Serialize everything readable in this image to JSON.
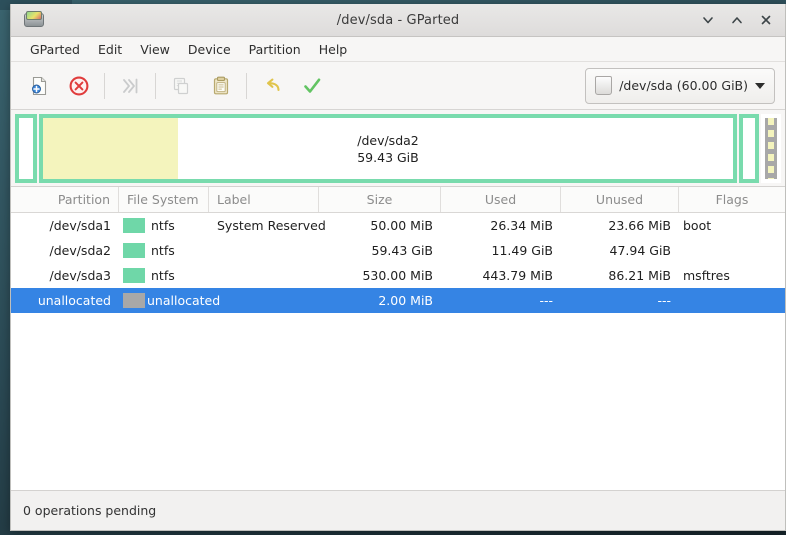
{
  "window": {
    "title": "/dev/sda - GParted",
    "app_icon": "hard-disk-icon",
    "controls": [
      {
        "name": "minimize-button",
        "icon": "chevron-down-icon"
      },
      {
        "name": "maximize-button",
        "icon": "chevron-up-icon"
      },
      {
        "name": "close-button",
        "icon": "close-x-icon"
      }
    ]
  },
  "menubar": {
    "items": [
      {
        "label": "GParted"
      },
      {
        "label": "Edit"
      },
      {
        "label": "View"
      },
      {
        "label": "Device"
      },
      {
        "label": "Partition"
      },
      {
        "label": "Help"
      }
    ]
  },
  "toolbar": {
    "buttons": [
      {
        "name": "new-partition-button",
        "icon": "new-document-icon",
        "enabled": true
      },
      {
        "name": "delete-partition-button",
        "icon": "delete-circle-icon",
        "enabled": true
      },
      {
        "name": "resize-move-button",
        "icon": "resize-move-icon",
        "enabled": false
      },
      {
        "name": "copy-button",
        "icon": "copy-icon",
        "enabled": false
      },
      {
        "name": "paste-button",
        "icon": "paste-clipboard-icon",
        "enabled": true
      },
      {
        "name": "undo-button",
        "icon": "undo-arrow-icon",
        "enabled": true
      },
      {
        "name": "apply-button",
        "icon": "apply-checkmark-icon",
        "enabled": true
      }
    ],
    "device_select": {
      "label": "/dev/sda (60.00 GiB)",
      "icon": "hard-drive-icon"
    }
  },
  "disk_graphic": {
    "partitions": [
      {
        "name": "/dev/sda1",
        "display_label": "",
        "flex": 13,
        "used_percent": 0,
        "style": "normal"
      },
      {
        "name": "/dev/sda2",
        "display_label": "/dev/sda2",
        "size_label": "59.43 GiB",
        "flex": 700,
        "used_percent": 19,
        "style": "normal"
      },
      {
        "name": "/dev/sda3",
        "display_label": "",
        "flex": 15,
        "used_percent": 0,
        "style": "normal"
      },
      {
        "name": "unallocated",
        "display_label": "",
        "flex": 20,
        "used_percent": 0,
        "style": "unallocated"
      }
    ]
  },
  "partition_table": {
    "headers": [
      "Partition",
      "File System",
      "Label",
      "Size",
      "Used",
      "Unused",
      "Flags"
    ],
    "rows": [
      {
        "partition": "/dev/sda1",
        "filesystem": "ntfs",
        "fs_color": "#6fd7a8",
        "label": "System Reserved",
        "size": "50.00 MiB",
        "used": "26.34 MiB",
        "unused": "23.66 MiB",
        "flags": "boot",
        "selected": false
      },
      {
        "partition": "/dev/sda2",
        "filesystem": "ntfs",
        "fs_color": "#6fd7a8",
        "label": "",
        "size": "59.43 GiB",
        "used": "11.49 GiB",
        "unused": "47.94 GiB",
        "flags": "",
        "selected": false
      },
      {
        "partition": "/dev/sda3",
        "filesystem": "ntfs",
        "fs_color": "#6fd7a8",
        "label": "",
        "size": "530.00 MiB",
        "used": "443.79 MiB",
        "unused": "86.21 MiB",
        "flags": "msftres",
        "selected": false
      },
      {
        "partition": "unallocated",
        "filesystem": "unallocated",
        "fs_color": "#a8a8a8",
        "label": "",
        "size": "2.00 MiB",
        "used": "---",
        "unused": "---",
        "flags": "",
        "selected": true
      }
    ]
  },
  "statusbar": {
    "text": "0 operations pending"
  },
  "colors": {
    "selection": "#3584e4",
    "ntfs": "#6fd7a8",
    "unallocated": "#a8a8a8",
    "used_fill": "#f4f4bd",
    "partition_border": "#79dbad"
  }
}
